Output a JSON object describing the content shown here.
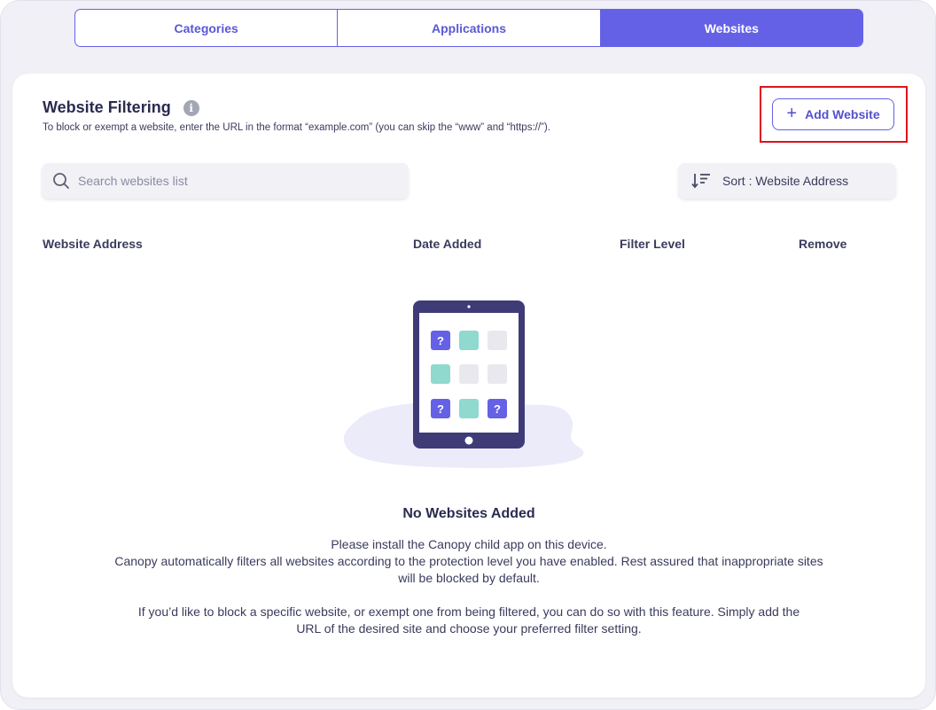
{
  "tabs": [
    {
      "label": "Categories",
      "active": false
    },
    {
      "label": "Applications",
      "active": false
    },
    {
      "label": "Websites",
      "active": true
    }
  ],
  "section": {
    "title": "Website Filtering",
    "info_icon": "info-icon",
    "subtitle": "To block or exempt a website, enter the URL in the format “example.com” (you can skip the “www” and “https://”).",
    "add_button": "Add Website"
  },
  "search": {
    "placeholder": "Search websites list",
    "value": ""
  },
  "sort": {
    "label": "Sort : Website Address"
  },
  "table": {
    "columns": [
      "Website Address",
      "Date Added",
      "Filter Level",
      "Remove"
    ]
  },
  "empty": {
    "title": "No Websites Added",
    "line1": "Please install the Canopy child app on this device.",
    "line2": "Canopy automatically filters all websites according to the protection level you have enabled. Rest assured that inappropriate sites will be blocked by default.",
    "line3": "If you’d like to block a specific website, or exempt one from being filtered, you can do so with this feature. Simply add the URL of the desired site and choose your preferred filter setting.",
    "illustration_glyph": "?"
  },
  "colors": {
    "accent": "#6461e6",
    "teal": "#8fd9cf",
    "highlight": "#e0121b",
    "tablet": "#3e3b77"
  }
}
